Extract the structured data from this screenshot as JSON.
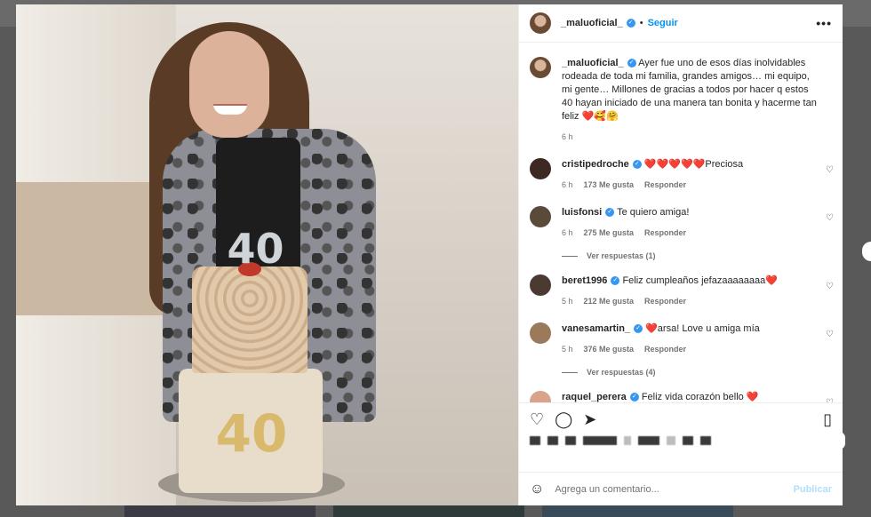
{
  "post": {
    "username": "_maluoficial_",
    "follow_label": "Seguir",
    "dot": "•",
    "more_label": "•••",
    "caption": "Ayer fue uno de esos días inolvidables rodeada de toda mi familia, grandes amigos… mi equipo, mi gente… Millones de gracias a todos por hacer q estos 40 hayan iniciado de una manera tan bonita y hacerme tan feliz ❤️🥰🤗",
    "caption_time": "6 h",
    "photo_candle": "40",
    "photo_cake_number": "40"
  },
  "comments": [
    {
      "username": "cristipedroche",
      "text": "❤️❤️❤️❤️❤️Preciosa",
      "time": "6 h",
      "likes": "173 Me gusta",
      "reply": "Responder",
      "avatar_color": "#3c2a22"
    },
    {
      "username": "luisfonsi",
      "text": "Te quiero amiga!",
      "time": "6 h",
      "likes": "275 Me gusta",
      "reply": "Responder",
      "avatar_color": "#5a4a3a",
      "replies": "Ver respuestas (1)"
    },
    {
      "username": "beret1996",
      "text": "Feliz cumpleaños jefazaaaaaaaa❤️",
      "time": "5 h",
      "likes": "212 Me gusta",
      "reply": "Responder",
      "avatar_color": "#4a3a32"
    },
    {
      "username": "vanesamartin_",
      "text": "❤️arsa! Love u amiga mía",
      "time": "5 h",
      "likes": "376 Me gusta",
      "reply": "Responder",
      "avatar_color": "#9a7a5a",
      "replies": "Ver respuestas (4)"
    },
    {
      "username": "raquel_perera",
      "text": "Feliz vida corazón bello ❤️",
      "time": "",
      "likes": "",
      "reply": "",
      "avatar_color": "#d7a38a"
    }
  ],
  "icons": {
    "like": "heart-icon",
    "comment": "comment-icon",
    "share": "share-icon",
    "save": "bookmark-icon",
    "emoji": "emoji-icon",
    "small_like": "heart-icon"
  },
  "add_comment": {
    "placeholder": "Agrega un comentario...",
    "publish_label": "Publicar"
  },
  "colors": {
    "accent": "#0095f6",
    "verified": "#3797f0",
    "publish_disabled": "#b2dffc"
  }
}
